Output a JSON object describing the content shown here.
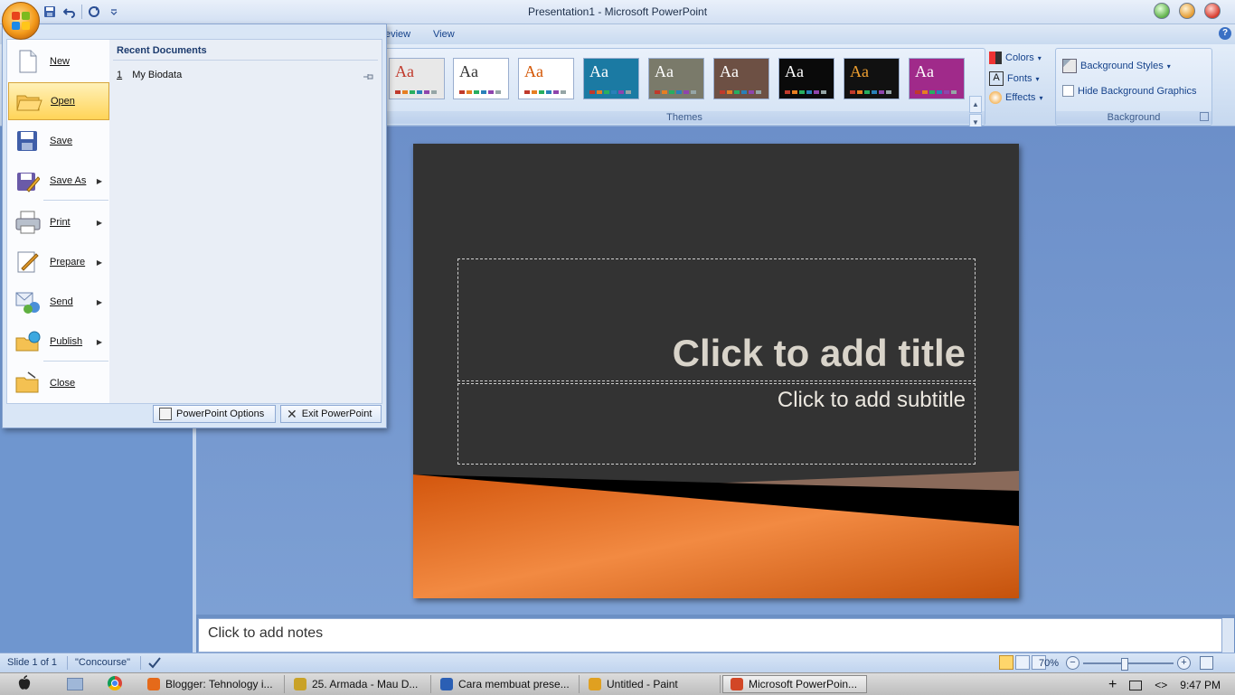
{
  "window": {
    "title": "Presentation1 - Microsoft PowerPoint"
  },
  "ribbon": {
    "tabs": [
      "eview",
      "View"
    ],
    "themes_label": "Themes",
    "background_label": "Background",
    "colors_label": "Colors",
    "fonts_label": "Fonts",
    "effects_label": "Effects",
    "background_styles_label": "Background Styles",
    "hide_bg_graphics_label": "Hide Background Graphics",
    "theme_thumbs": [
      {
        "aa": "Aa",
        "bg": "#e8e8e8",
        "fg": "#c0392b"
      },
      {
        "aa": "Aa",
        "bg": "#ffffff",
        "fg": "#333333"
      },
      {
        "aa": "Aa",
        "bg": "#ffffff",
        "fg": "#d35400"
      },
      {
        "aa": "Aa",
        "bg": "#1b7aa3",
        "fg": "#ffffff"
      },
      {
        "aa": "Aa",
        "bg": "#7a7a6a",
        "fg": "#ffffff"
      },
      {
        "aa": "Aa",
        "bg": "#6d5044",
        "fg": "#ffffff"
      },
      {
        "aa": "Aa",
        "bg": "#0a0a0a",
        "fg": "#ffffff"
      },
      {
        "aa": "Aa",
        "bg": "#111111",
        "fg": "#f0a030"
      },
      {
        "aa": "Aa",
        "bg": "#a02a8a",
        "fg": "#ffffff"
      }
    ]
  },
  "office_menu": {
    "items": [
      {
        "label": "New",
        "has_arrow": false,
        "icon": "new-doc-icon"
      },
      {
        "label": "Open",
        "has_arrow": false,
        "icon": "open-folder-icon"
      },
      {
        "label": "Save",
        "has_arrow": false,
        "icon": "save-icon"
      },
      {
        "label": "Save As",
        "has_arrow": true,
        "icon": "save-as-icon"
      },
      {
        "label": "Print",
        "has_arrow": true,
        "icon": "print-icon"
      },
      {
        "label": "Prepare",
        "has_arrow": true,
        "icon": "prepare-icon"
      },
      {
        "label": "Send",
        "has_arrow": true,
        "icon": "send-icon"
      },
      {
        "label": "Publish",
        "has_arrow": true,
        "icon": "publish-icon"
      },
      {
        "label": "Close",
        "has_arrow": false,
        "icon": "close-folder-icon"
      }
    ],
    "recent_header": "Recent Documents",
    "recent": [
      {
        "num": "1",
        "name": "My Biodata"
      }
    ],
    "options_label": "PowerPoint Options",
    "exit_label": "Exit PowerPoint"
  },
  "slide": {
    "title_placeholder": "Click to add title",
    "subtitle_placeholder": "Click to add subtitle"
  },
  "notes": {
    "placeholder": "Click to add notes"
  },
  "statusbar": {
    "slide_info": "Slide 1 of 1",
    "theme_name": "\"Concourse\"",
    "zoom": "70%"
  },
  "taskbar": {
    "items": [
      {
        "label": "Blogger: Tehnology i...",
        "color": "#e56a1a"
      },
      {
        "label": "25. Armada - Mau D...",
        "color": "#c9a227"
      },
      {
        "label": "Cara membuat prese...",
        "color": "#2b5fb4"
      },
      {
        "label": "Untitled - Paint",
        "color": "#e0a020"
      },
      {
        "label": "Microsoft PowerPoin...",
        "color": "#d24726"
      }
    ],
    "clock": "9:47 PM"
  }
}
